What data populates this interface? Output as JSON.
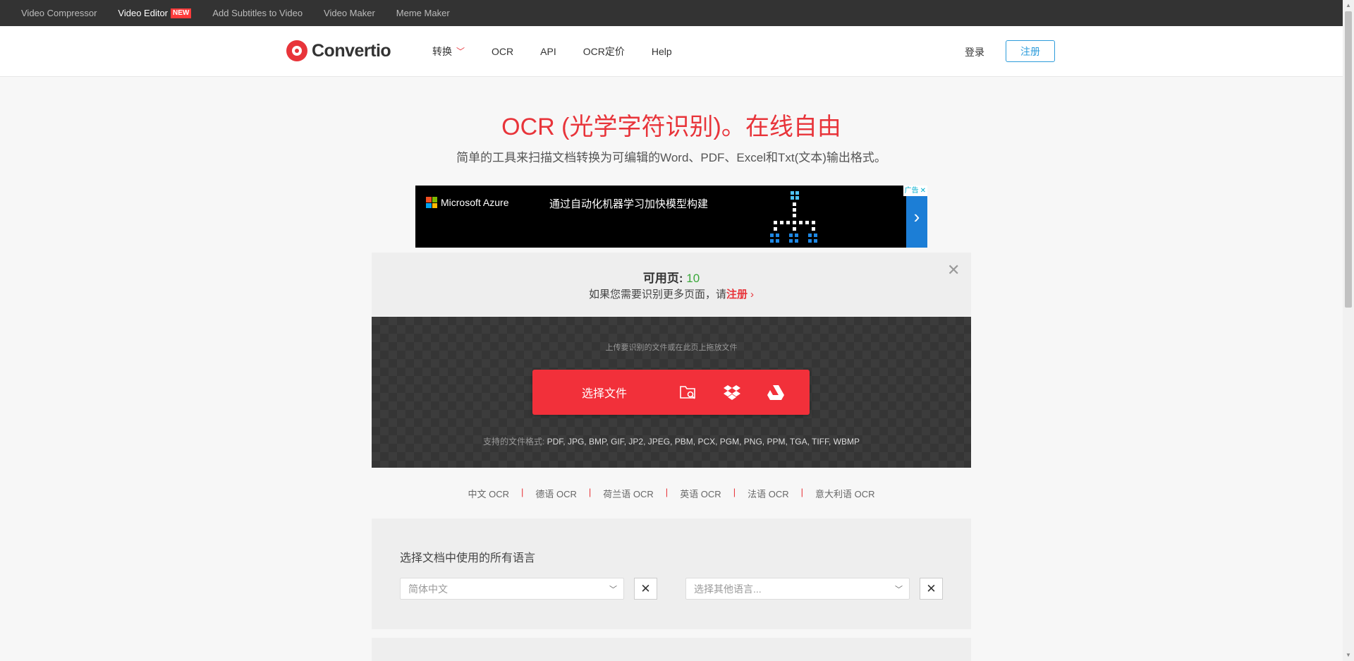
{
  "topbar": {
    "links": [
      "Video Compressor",
      "Video Editor",
      "Add Subtitles to Video",
      "Video Maker",
      "Meme Maker"
    ],
    "new_badge": "NEW"
  },
  "header": {
    "logo_text": "Convertio",
    "nav": [
      "转换",
      "OCR",
      "API",
      "OCR定价",
      "Help"
    ],
    "login": "登录",
    "signup": "注册"
  },
  "hero": {
    "title": "OCR (光学字符识别)。在线自由",
    "subtitle": "简单的工具来扫描文档转换为可编辑的Word、PDF、Excel和Txt(文本)输出格式。"
  },
  "ad": {
    "brand": "Microsoft Azure",
    "text": "通过自动化机器学习加快模型构建",
    "ad_label": "广告",
    "arrow": "›"
  },
  "upload": {
    "pages_label": "可用页:",
    "pages_count": "10",
    "more_text": "如果您需要识别更多页面，请",
    "more_link": "注册",
    "drop_hint": "上传要识别的文件或在此页上拖放文件",
    "choose_label": "选择文件",
    "formats_label": "支持的文件格式:",
    "formats": "PDF, JPG, BMP, GIF, JP2, JPEG, PBM, PCX, PGM, PNG, PPM, TGA, TIFF, WBMP"
  },
  "ocr_langs": [
    "中文 OCR",
    "德语 OCR",
    "荷兰语 OCR",
    "英语 OCR",
    "法语 OCR",
    "意大利语 OCR"
  ],
  "language_select": {
    "title": "选择文档中使用的所有语言",
    "primary_value": "简体中文",
    "secondary_placeholder": "选择其他语言..."
  },
  "colors": {
    "brand_red": "#e8343a",
    "accent_blue": "#2d9cdb",
    "count_green": "#3aa83a"
  }
}
